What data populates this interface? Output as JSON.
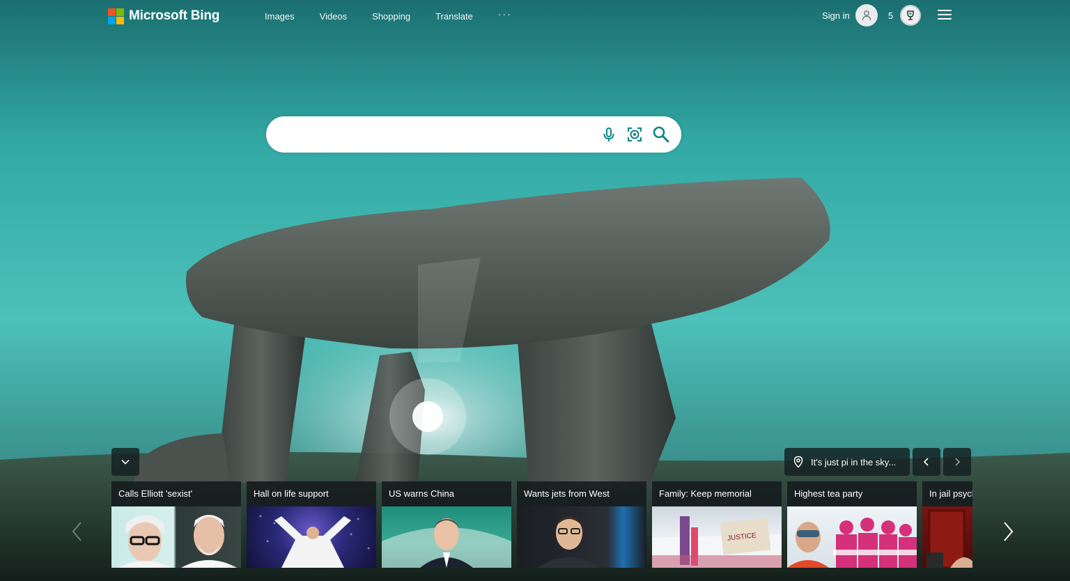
{
  "brand": {
    "name": "Microsoft Bing",
    "colors": [
      "#f25022",
      "#7fba00",
      "#00a4ef",
      "#ffb900"
    ]
  },
  "nav": {
    "items": [
      {
        "label": "Images"
      },
      {
        "label": "Videos"
      },
      {
        "label": "Shopping"
      },
      {
        "label": "Translate"
      }
    ],
    "more": "···"
  },
  "account": {
    "signin_label": "Sign in",
    "avatar_icon": "person-icon",
    "rewards_count": "5",
    "rewards_icon": "trophy-icon",
    "menu_icon": "hamburger-icon"
  },
  "search": {
    "value": "",
    "placeholder": "",
    "icons": [
      "microphone-icon",
      "visual-search-icon",
      "search-icon"
    ],
    "accent": "#0c8484"
  },
  "background": {
    "info_text": "It's just pi in the sky...",
    "info_icon": "location-pin-icon"
  },
  "news": {
    "items": [
      {
        "title": "Calls Elliott 'sexist'"
      },
      {
        "title": "Hall on life support"
      },
      {
        "title": "US warns China"
      },
      {
        "title": "Wants jets from West"
      },
      {
        "title": "Family: Keep memorial"
      },
      {
        "title": "Highest tea party"
      },
      {
        "title": "In jail psychiatric"
      }
    ]
  }
}
